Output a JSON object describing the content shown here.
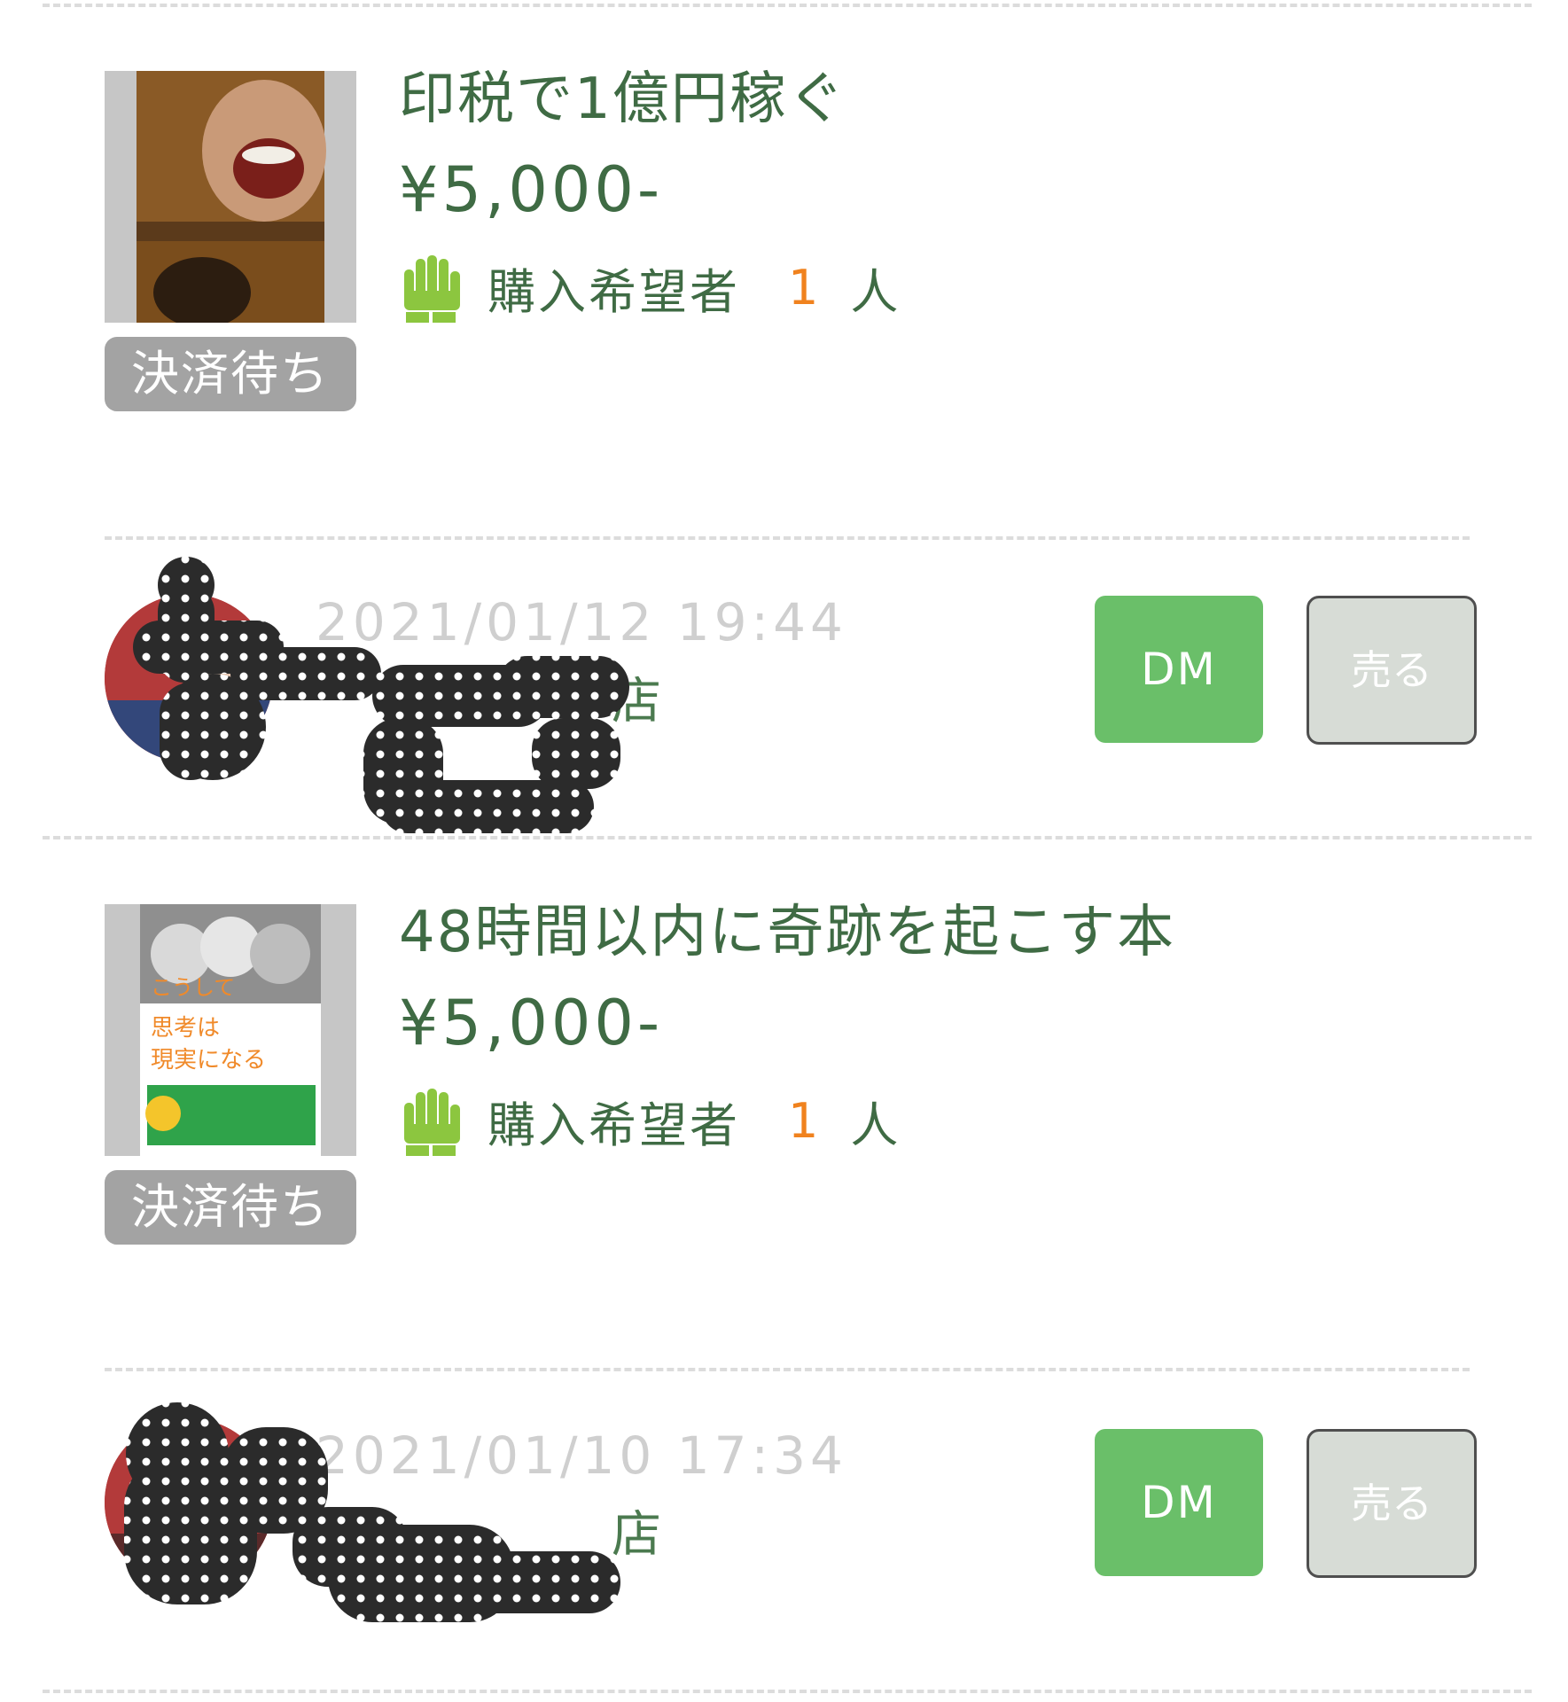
{
  "colors": {
    "title_green": "#3f6b44",
    "count_orange": "#f0821e",
    "dm_green": "#6abf69",
    "badge_gray": "#a3a3a3",
    "sell_bg": "#d7dcd6"
  },
  "items": [
    {
      "cover_icon": "book-cover-image",
      "cover_text": "印税で1億円稼ぐ",
      "status": "決済待ち",
      "title": "印税で1億円稼ぐ",
      "price": "¥5,000-",
      "wishers_icon": "raised-hand-icon",
      "wishers_label": "購入希望者",
      "wishers_count": "1",
      "wishers_unit": "人",
      "buyer": {
        "avatar_icon": "buyer-avatar-image",
        "date": "2021/01/12 19:44",
        "name_visible": "店",
        "dm_label": "DM",
        "sell_label": "売る"
      }
    },
    {
      "cover_icon": "book-cover-image",
      "cover_text": "こうして思考は現実になる",
      "status": "決済待ち",
      "title": "48時間以内に奇跡を起こす本",
      "price": "¥5,000-",
      "wishers_icon": "raised-hand-icon",
      "wishers_label": "購入希望者",
      "wishers_count": "1",
      "wishers_unit": "人",
      "buyer": {
        "avatar_icon": "buyer-avatar-image",
        "date": "2021/01/10 17:34",
        "name_visible": "店",
        "dm_label": "DM",
        "sell_label": "売る"
      }
    }
  ]
}
